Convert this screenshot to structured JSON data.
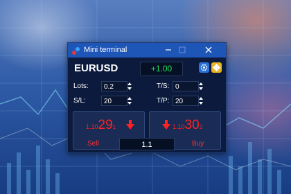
{
  "window": {
    "title": "Mini terminal"
  },
  "instrument": {
    "symbol": "EURUSD",
    "pnl": "+1.00"
  },
  "params": {
    "lots_label": "Lots:",
    "lots_value": "0.2",
    "sl_label": "S/L:",
    "sl_value": "20",
    "ts_label": "T/S:",
    "ts_value": "0",
    "tp_label": "T/P:",
    "tp_value": "20"
  },
  "sell": {
    "price_prefix": "1.10",
    "price_main": "29",
    "price_suffix": "1",
    "label": "Sell"
  },
  "buy": {
    "price_prefix": "1.10",
    "price_main": "30",
    "price_suffix": "2",
    "label": "Buy"
  },
  "volume": "1.1",
  "icons": {
    "app": "app-logo-icon",
    "minimize": "minimize-icon",
    "maximize": "maximize-icon",
    "close": "close-icon",
    "gear": "gear-icon",
    "settings": "settings-icon",
    "sell_arrow": "arrow-down-icon",
    "buy_arrow": "arrow-down-icon"
  },
  "colors": {
    "titlebar": "#1e56b8",
    "pnl_green": "#1ee05a",
    "price_red": "#ff2222",
    "gear_blue": "#2a72d6",
    "settings_yellow": "#e6b626"
  }
}
